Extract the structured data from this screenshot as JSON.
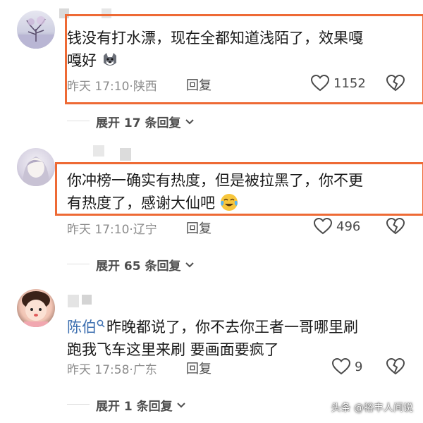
{
  "comments": [
    {
      "text_line1": "钱没有打水漂，现在全都知道浅陌了，效果嘎",
      "text_line2": "嘎好",
      "emoji": "dog-face-emoji",
      "time": "昨天 17:10",
      "location": "陕西",
      "reply_label": "回复",
      "like_count": "1152",
      "expand_label": "展开 17 条回复"
    },
    {
      "text_line1": "你冲榜一确实有热度，但是被拉黑了，你不更",
      "text_line2": "有热度了，感谢大仙吧",
      "emoji": "crying-laughing-emoji",
      "time": "昨天 17:10",
      "location": "辽宁",
      "reply_label": "回复",
      "like_count": "496",
      "expand_label": "展开 65 条回复"
    },
    {
      "username": "陈伯",
      "text_line1": "昨晚都说了，你不去你王者一哥哪里刷",
      "text_line2": "跑我飞车这里来刷 要画面要疯了",
      "time": "昨天 17:58",
      "location": "广东",
      "reply_label": "回复",
      "like_count": "9",
      "expand_label": "展开 1 条回复"
    }
  ],
  "watermark": "头条 @裕丰人间说",
  "colors": {
    "highlight": "#ee6a35",
    "username": "#3d6fb0"
  }
}
